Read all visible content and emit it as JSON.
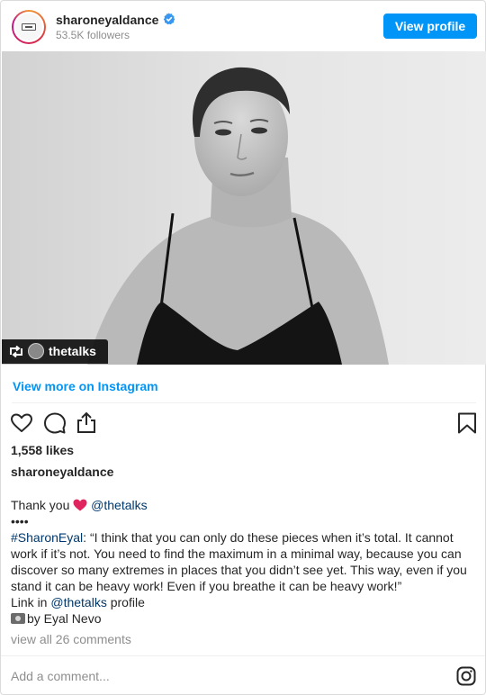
{
  "header": {
    "username": "sharoneyaldance",
    "followers": "53.5K followers",
    "view_profile_label": "View profile"
  },
  "photo": {
    "repost_username": "thetalks"
  },
  "view_more_label": "View more on Instagram",
  "likes": "1,558 likes",
  "poster_username": "sharoneyaldance",
  "caption": {
    "thank_you": "Thank you",
    "mention_1": "@thetalks",
    "dots": "••••",
    "hashtag": "#SharonEyal",
    "quote": ": “I think that you can only do these pieces when it’s total. It cannot work if it’s not. You need to find the maximum in a minimal way, because you can discover so many extremes in places that you didn’t see yet. This way, even if you stand it can be heavy work! Even if you breathe it can be heavy work!”",
    "link_in": "Link in",
    "mention_2": "@thetalks",
    "profile_word": "profile",
    "credit": "by Eyal Nevo"
  },
  "comments_link": "view all 26 comments",
  "add_comment_placeholder": "Add a comment...",
  "colors": {
    "accent_blue": "#0095f6",
    "mention_blue": "#00376b",
    "muted_gray": "#8e8e8e"
  }
}
